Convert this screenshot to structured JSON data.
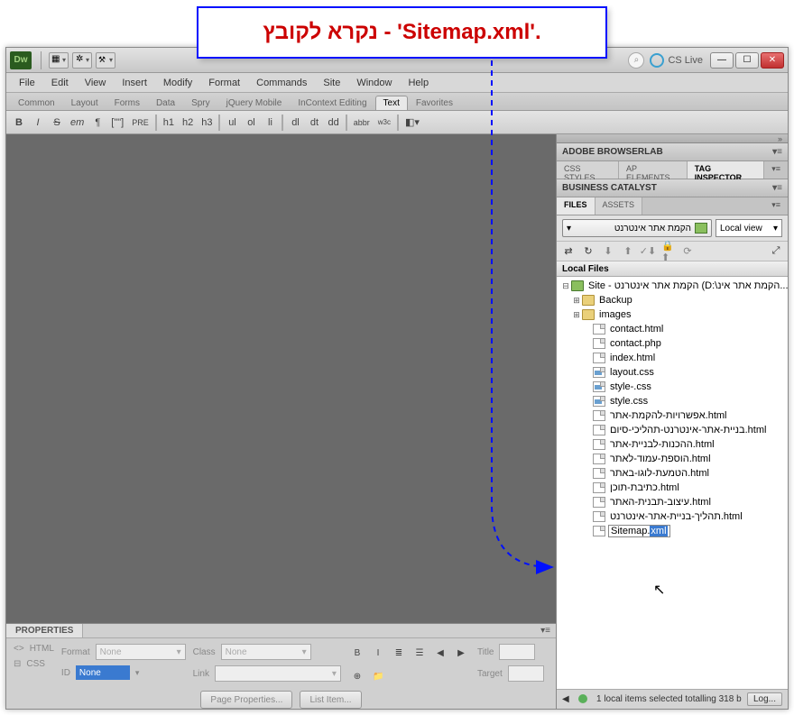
{
  "callout": "נקרא לקובץ - 'Sitemap.xml'.",
  "titlebar": {
    "logo": "Dw",
    "cslive": "CS Live"
  },
  "menu": [
    "File",
    "Edit",
    "View",
    "Insert",
    "Modify",
    "Format",
    "Commands",
    "Site",
    "Window",
    "Help"
  ],
  "insertTabs": [
    "Common",
    "Layout",
    "Forms",
    "Data",
    "Spry",
    "jQuery Mobile",
    "InContext Editing",
    "Text",
    "Favorites"
  ],
  "insertTabActive": "Text",
  "formatBtns": [
    "B",
    "I",
    "S",
    "em",
    "¶",
    "[\"\"]",
    "PRE",
    "h1",
    "h2",
    "h3",
    "ul",
    "ol",
    "li",
    "dl",
    "dt",
    "dd",
    "abbr",
    "w3c"
  ],
  "prop": {
    "title": "PROPERTIES",
    "modeHtml": "HTML",
    "modeCss": "CSS",
    "labels": {
      "format": "Format",
      "id": "ID",
      "class": "Class",
      "link": "Link",
      "title2": "Title",
      "target": "Target"
    },
    "formatVal": "None",
    "idVal": "None",
    "classVal": "None",
    "pageProps": "Page Properties...",
    "listItem": "List Item..."
  },
  "sidepanel": {
    "browserlab": "ADOBE BROWSERLAB",
    "tabs1": [
      "CSS STYLES",
      "AP ELEMENTS",
      "TAG INSPECTOR"
    ],
    "tab1Active": "TAG INSPECTOR",
    "bc": "BUSINESS CATALYST",
    "tabs2": [
      "FILES",
      "ASSETS"
    ],
    "tab2Active": "FILES",
    "siteName": "הקמת אתר אינטרנט",
    "viewMode": "Local view",
    "localFilesHdr": "Local Files",
    "rootLabel": "Site - הקמת אתר אינטרנט (D:\\הקמת אתר אינ...",
    "folders": [
      "Backup",
      "images"
    ],
    "files": [
      "contact.html",
      "contact.php",
      "index.html",
      "layout.css",
      "style-.css",
      "style.css",
      "אפשרויות-להקמת-אתר.html",
      "בניית-אתר-אינטרנט-תהליכי-סיום.html",
      "ההכנות-לבניית-אתר.html",
      "הוספת-עמוד-לאתר.html",
      "הטמעת-לוגו-באתר.html",
      "כתיבת-תוכן.html",
      "עיצוב-תבנית-האתר.html",
      "תהליך-בניית-אתר-אינטרנט.html"
    ],
    "editingBase": "Sitemap.",
    "editingSel": "xml",
    "status": "1 local items selected totalling 318 b",
    "logBtn": "Log..."
  }
}
